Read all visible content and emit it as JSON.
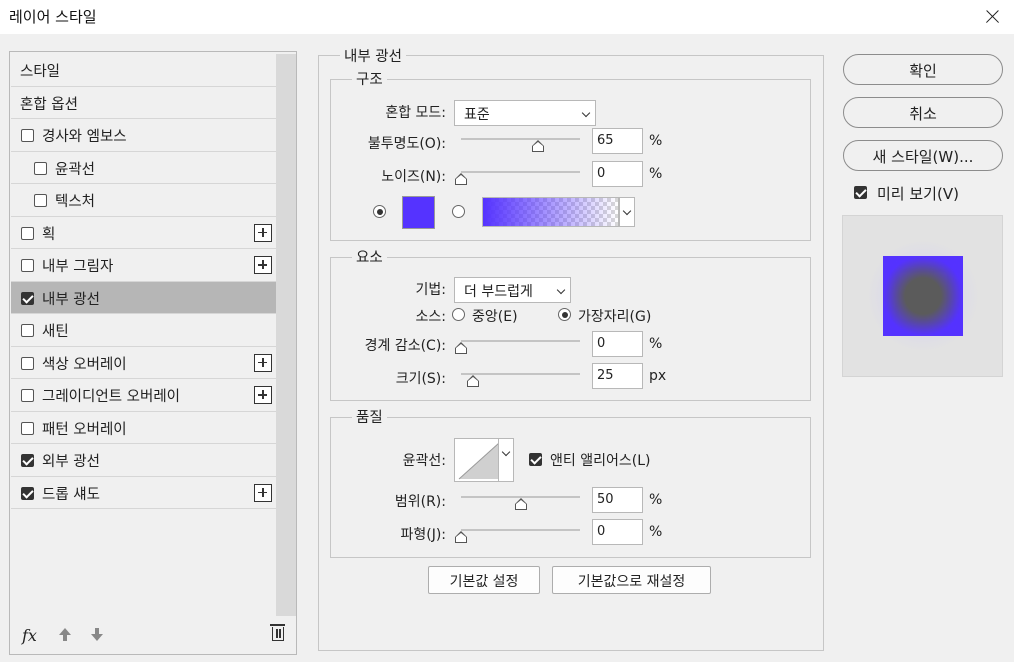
{
  "window": {
    "title": "레이어 스타일"
  },
  "styles_list": {
    "items": [
      {
        "label": "스타일",
        "checkbox": false,
        "checked": false,
        "indent": false,
        "plus": false,
        "selected": false
      },
      {
        "label": "혼합 옵션",
        "checkbox": false,
        "checked": false,
        "indent": false,
        "plus": false,
        "selected": false
      },
      {
        "label": "경사와 엠보스",
        "checkbox": true,
        "checked": false,
        "indent": false,
        "plus": false,
        "selected": false
      },
      {
        "label": "윤곽선",
        "checkbox": true,
        "checked": false,
        "indent": true,
        "plus": false,
        "selected": false
      },
      {
        "label": "텍스처",
        "checkbox": true,
        "checked": false,
        "indent": true,
        "plus": false,
        "selected": false
      },
      {
        "label": "획",
        "checkbox": true,
        "checked": false,
        "indent": false,
        "plus": true,
        "selected": false
      },
      {
        "label": "내부 그림자",
        "checkbox": true,
        "checked": false,
        "indent": false,
        "plus": true,
        "selected": false
      },
      {
        "label": "내부 광선",
        "checkbox": true,
        "checked": true,
        "indent": false,
        "plus": false,
        "selected": true
      },
      {
        "label": "새틴",
        "checkbox": true,
        "checked": false,
        "indent": false,
        "plus": false,
        "selected": false
      },
      {
        "label": "색상 오버레이",
        "checkbox": true,
        "checked": false,
        "indent": false,
        "plus": true,
        "selected": false
      },
      {
        "label": "그레이디언트 오버레이",
        "checkbox": true,
        "checked": false,
        "indent": false,
        "plus": true,
        "selected": false
      },
      {
        "label": "패턴 오버레이",
        "checkbox": true,
        "checked": false,
        "indent": false,
        "plus": false,
        "selected": false
      },
      {
        "label": "외부 광선",
        "checkbox": true,
        "checked": true,
        "indent": false,
        "plus": false,
        "selected": false
      },
      {
        "label": "드롭 섀도",
        "checkbox": true,
        "checked": true,
        "indent": false,
        "plus": true,
        "selected": false
      }
    ],
    "fx_label": "fx"
  },
  "panel": {
    "title": "내부 광선",
    "structure": {
      "title": "구조",
      "blend_mode_label": "혼합 모드:",
      "blend_mode_value": "표준",
      "opacity_label": "불투명도(O):",
      "opacity_value": "65",
      "noise_label": "노이즈(N):",
      "noise_value": "0",
      "percent": "%",
      "glow_color": "#5533ff"
    },
    "elements": {
      "title": "요소",
      "technique_label": "기법:",
      "technique_value": "더 부드럽게",
      "source_label": "소스:",
      "source_center": "중앙(E)",
      "source_edge": "가장자리(G)",
      "source_selected": "edge",
      "choke_label": "경계 감소(C):",
      "choke_value": "0",
      "size_label": "크기(S):",
      "size_value": "25",
      "px": "px",
      "percent": "%"
    },
    "quality": {
      "title": "품질",
      "contour_label": "윤곽선:",
      "antialias_label": "앤티 앨리어스(L)",
      "antialias_checked": true,
      "range_label": "범위(R):",
      "range_value": "50",
      "jitter_label": "파형(J):",
      "jitter_value": "0",
      "percent": "%"
    },
    "buttons": {
      "make_default": "기본값 설정",
      "reset_default": "기본값으로 재설정"
    }
  },
  "right": {
    "ok": "확인",
    "cancel": "취소",
    "new_style": "새 스타일(W)...",
    "preview_label": "미리 보기(V)",
    "preview_checked": true,
    "preview_fill": "#5b5b5b",
    "preview_glow": "#5533ff"
  }
}
